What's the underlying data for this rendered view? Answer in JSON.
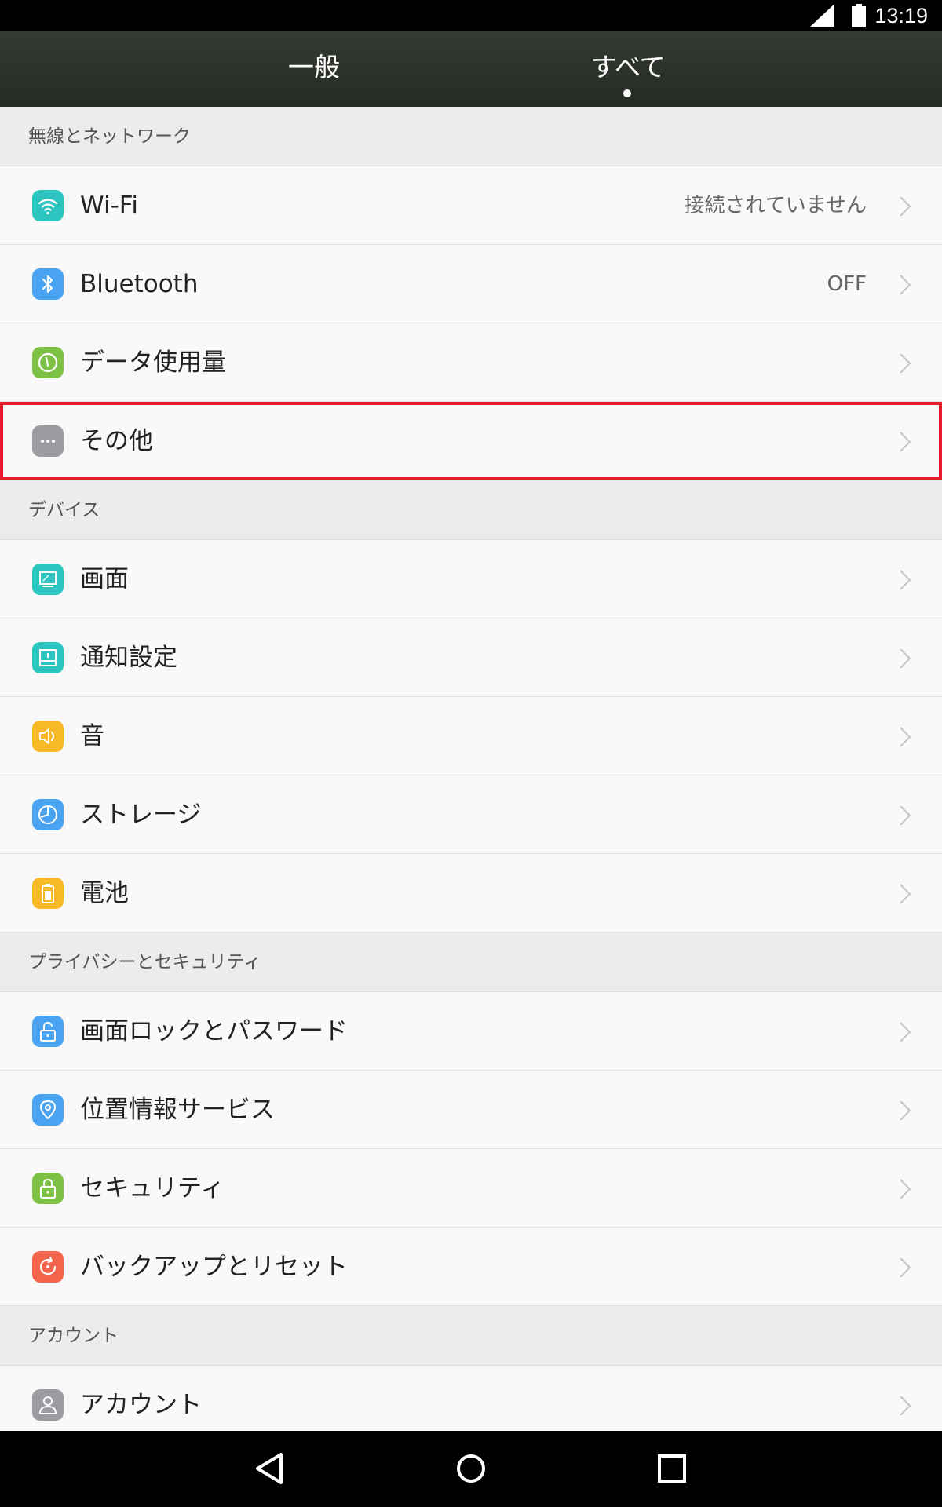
{
  "status_bar": {
    "time": "13:19",
    "icons": [
      "signal-icon",
      "battery-icon"
    ]
  },
  "tabs": {
    "general": "一般",
    "all": "すべて"
  },
  "sections": [
    {
      "title": "無線とネットワーク",
      "items": [
        {
          "label": "Wi-Fi",
          "value": "接続されていません",
          "icon": "wifi-icon",
          "color": "#2bc4be"
        },
        {
          "label": "Bluetooth",
          "value": "OFF",
          "icon": "bluetooth-icon",
          "color": "#4aa3f0"
        },
        {
          "label": "データ使用量",
          "value": "",
          "icon": "data-usage-icon",
          "color": "#7dc244"
        },
        {
          "label": "その他",
          "value": "",
          "icon": "more-icon",
          "color": "#9b9ba2"
        }
      ]
    },
    {
      "title": "デバイス",
      "items": [
        {
          "label": "画面",
          "value": "",
          "icon": "display-icon",
          "color": "#2bc4be"
        },
        {
          "label": "通知設定",
          "value": "",
          "icon": "notification-icon",
          "color": "#2bc4be"
        },
        {
          "label": "音",
          "value": "",
          "icon": "sound-icon",
          "color": "#f8b928"
        },
        {
          "label": "ストレージ",
          "value": "",
          "icon": "storage-icon",
          "color": "#4aa3f0"
        },
        {
          "label": "電池",
          "value": "",
          "icon": "battery-icon",
          "color": "#f8b928"
        }
      ]
    },
    {
      "title": "プライバシーとセキュリティ",
      "items": [
        {
          "label": "画面ロックとパスワード",
          "value": "",
          "icon": "unlock-icon",
          "color": "#4aa3f0"
        },
        {
          "label": "位置情報サービス",
          "value": "",
          "icon": "location-icon",
          "color": "#4aa3f0"
        },
        {
          "label": "セキュリティ",
          "value": "",
          "icon": "lock-icon",
          "color": "#7dc244"
        },
        {
          "label": "バックアップとリセット",
          "value": "",
          "icon": "backup-icon",
          "color": "#f2644b"
        }
      ]
    },
    {
      "title": "アカウント",
      "items": [
        {
          "label": "アカウント",
          "value": "",
          "icon": "account-icon",
          "color": "#9b9ba2"
        }
      ]
    }
  ],
  "highlight_color": "#e51d2a",
  "nav_bar": [
    "back-icon",
    "home-icon",
    "recents-icon"
  ]
}
